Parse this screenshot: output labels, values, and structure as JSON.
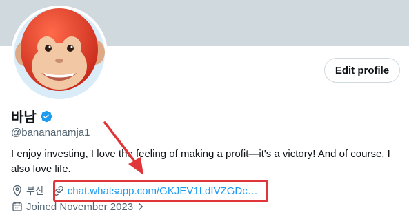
{
  "profile": {
    "display_name": "바남",
    "handle": "@banananamja1",
    "bio": "I enjoy investing, I love the feeling of making a profit—it's a victory! And of course, I also love life.",
    "location": "부산",
    "link": "chat.whatsapp.com/GKJEV1LdIVZGDc…",
    "joined": "Joined November 2023",
    "edit_label": "Edit profile"
  },
  "colors": {
    "banner": "#cfd9de",
    "link": "#1d9bf0",
    "verified": "#1d9bf0",
    "annotation": "#e0363a"
  },
  "icons": {
    "verified": "verified-badge-icon",
    "location": "location-pin-icon",
    "link": "link-icon",
    "calendar": "calendar-icon",
    "chevron": "chevron-right-icon"
  }
}
